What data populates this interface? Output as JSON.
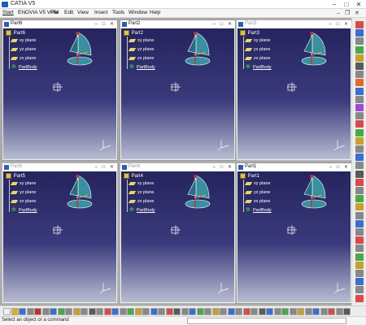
{
  "app": {
    "title": "CATIA V5"
  },
  "menus": [
    "Start",
    "ENOVIA V5 VPM",
    "File",
    "Edit",
    "View",
    "Insert",
    "Tools",
    "Window",
    "Help"
  ],
  "windows": [
    {
      "name": "Part6",
      "active": true
    },
    {
      "name": "Part2",
      "active": true
    },
    {
      "name": "Part3",
      "active": false
    },
    {
      "name": "Part5",
      "active": false
    },
    {
      "name": "Part4",
      "active": false
    },
    {
      "name": "Part1",
      "active": true
    }
  ],
  "tree": {
    "items": [
      "xy plane",
      "yz plane",
      "zx plane"
    ],
    "body": "PartBody"
  },
  "status": {
    "text": "Select an object or a command",
    "command_value": ""
  },
  "colors": {
    "viewport_top": "#25245e",
    "viewport_bottom": "#b9bdd2",
    "sail": "#3a8fa0",
    "plane_icon": "#e8d66a",
    "body_icon": "#54d454"
  }
}
